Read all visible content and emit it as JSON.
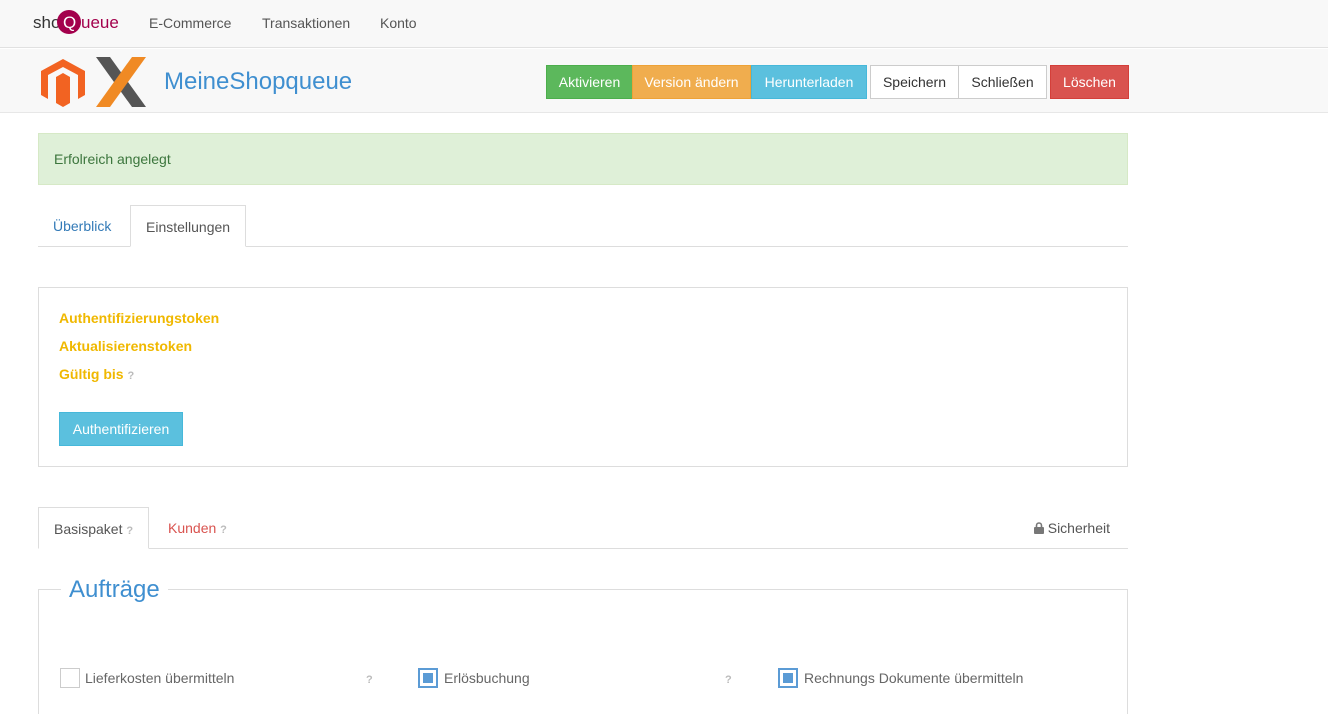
{
  "nav": {
    "logo_part1": "shop",
    "logo_part2": "Q",
    "logo_part3": "ueue",
    "links": [
      "E-Commerce",
      "Transaktionen",
      "Konto"
    ]
  },
  "header": {
    "title": "MeineShopqueue",
    "buttons": {
      "activate": "Aktivieren",
      "change_version": "Version ändern",
      "download": "Herunterladen",
      "save": "Speichern",
      "close": "Schließen",
      "delete": "Löschen"
    }
  },
  "alert": {
    "message": "Erfolreich angelegt"
  },
  "tabs": [
    "Überblick",
    "Einstellungen"
  ],
  "auth_panel": {
    "auth_token_label": "Authentifizierungstoken",
    "refresh_token_label": "Aktualisierenstoken",
    "valid_until_label": "Gültig bis",
    "help": "?",
    "authenticate_button": "Authentifizieren"
  },
  "settings_tabs": {
    "basic": "Basispaket",
    "customers": "Kunden",
    "help": "?",
    "security": "Sicherheit"
  },
  "orders": {
    "legend": "Aufträge",
    "options": [
      {
        "label": "Lieferkosten übermitteln",
        "checked": false
      },
      {
        "label": "Erlösbuchung",
        "checked": true
      },
      {
        "label": "Rechnungs Dokumente übermitteln",
        "checked": true
      }
    ],
    "help": "?"
  },
  "colors": {
    "brand": "#a3004c",
    "primary": "#3f8fd0",
    "success": "#5cb85c",
    "warning": "#f0ad4e",
    "info": "#5bc0de",
    "danger": "#d9534f",
    "token_label": "#f0b800"
  },
  "icons": [
    "magento-icon",
    "x-icon",
    "lock-icon"
  ]
}
